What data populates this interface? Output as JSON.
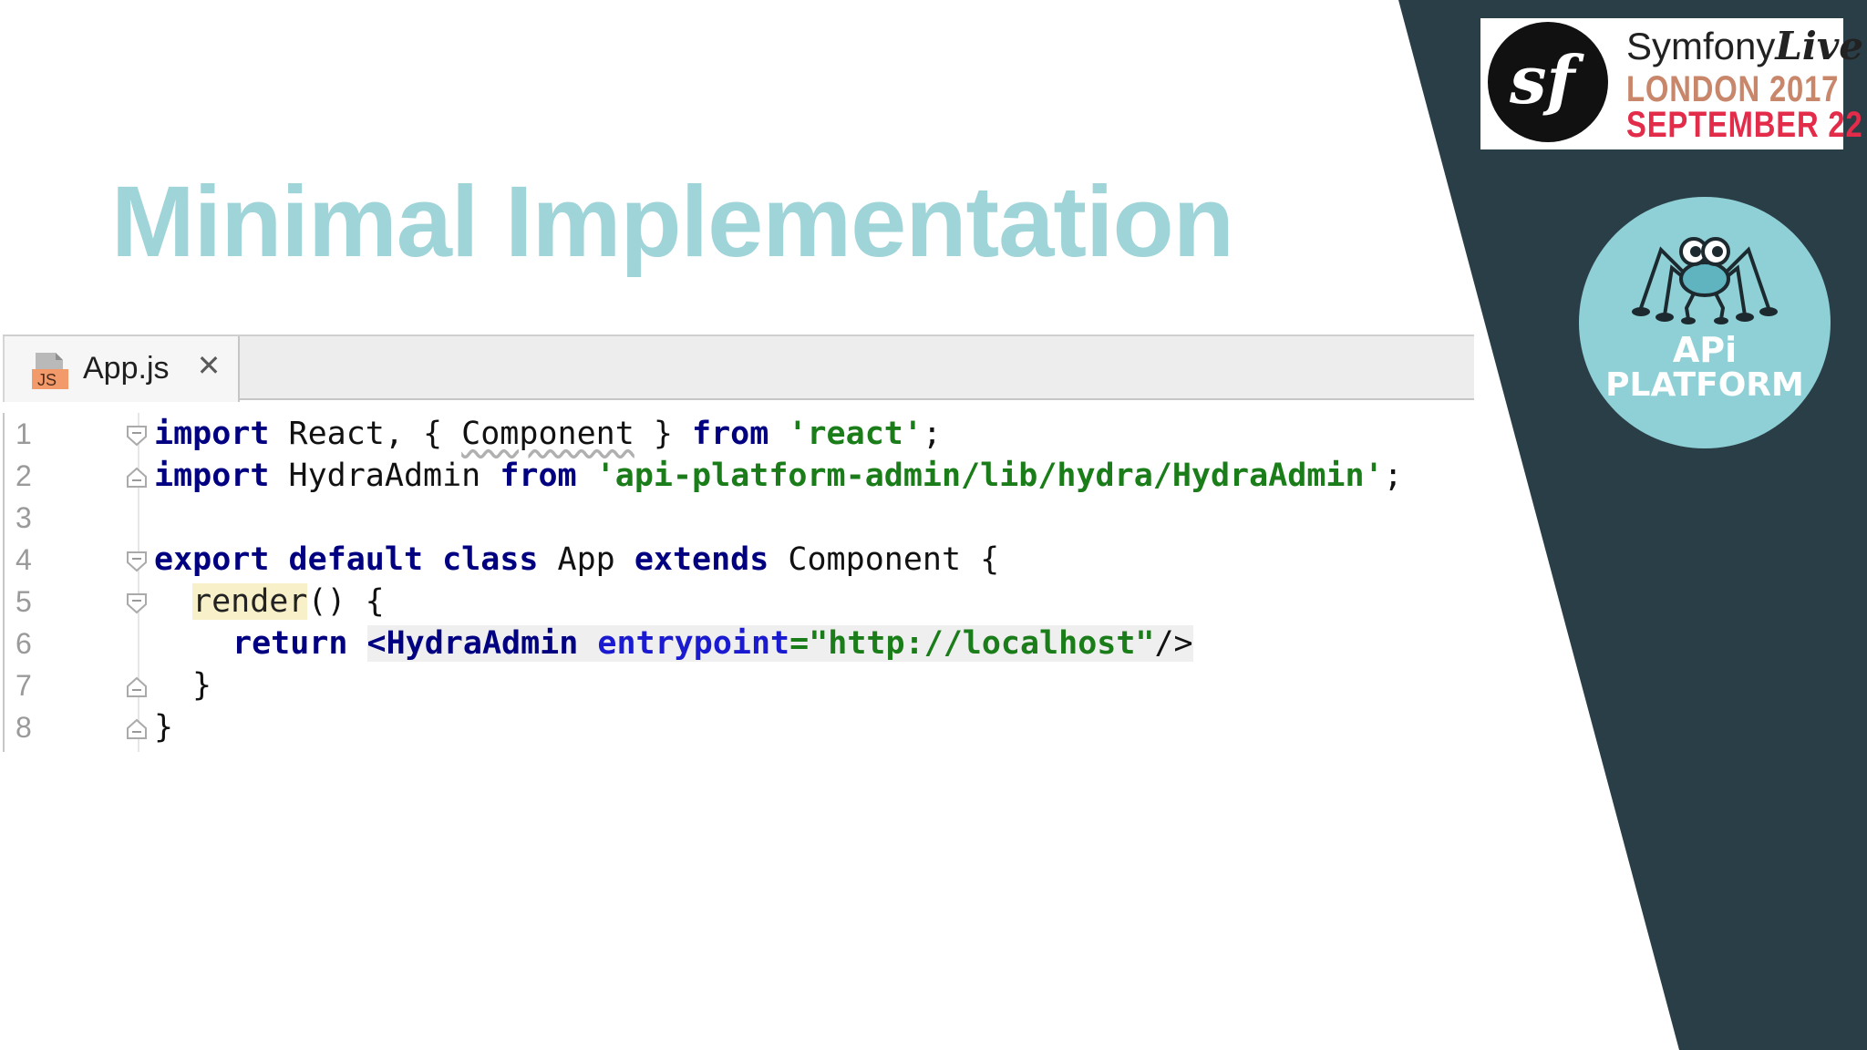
{
  "slide": {
    "title": "Minimal Implementation"
  },
  "editor": {
    "tab": {
      "file_icon": "js-file-icon",
      "file_icon_label": "JS",
      "label": "App.js",
      "close_glyph": "✕"
    },
    "lines": [
      {
        "num": "1"
      },
      {
        "num": "2"
      },
      {
        "num": "3"
      },
      {
        "num": "4"
      },
      {
        "num": "5"
      },
      {
        "num": "6"
      },
      {
        "num": "7"
      },
      {
        "num": "8"
      }
    ],
    "tokens": {
      "l1": [
        "import",
        " React, { ",
        "Component",
        " } ",
        "from",
        " ",
        "'react'",
        ";"
      ],
      "l2": [
        "import",
        " HydraAdmin ",
        "from",
        " ",
        "'api-platform-admin/lib/hydra/HydraAdmin'",
        ";"
      ],
      "l4": [
        "export",
        " ",
        "default",
        " ",
        "class",
        " App ",
        "extends",
        " Component {"
      ],
      "l5": [
        "render",
        "() {"
      ],
      "l6": [
        "return",
        " ",
        "<HydraAdmin",
        " ",
        "entrypoint",
        "=",
        "\"http://localhost\"",
        "/>"
      ],
      "l7": [
        "}"
      ],
      "l8": [
        "}"
      ]
    }
  },
  "logos": {
    "symfony": {
      "monogram": "sf",
      "brand": "Symfony",
      "brand_live": "Live",
      "city": "LONDON 2017",
      "date": "SEPTEMBER 22"
    },
    "api_platform": {
      "icon": "spider-mascot-icon",
      "line1": "APi",
      "line2": "PLATFORM"
    }
  },
  "colors": {
    "title": "#9fd4d8",
    "panel": "#2a3e47",
    "keyword": "#000080",
    "string": "#1a7d1a",
    "attribute": "#1a1ad0",
    "api_circle": "#8fd0d6"
  }
}
